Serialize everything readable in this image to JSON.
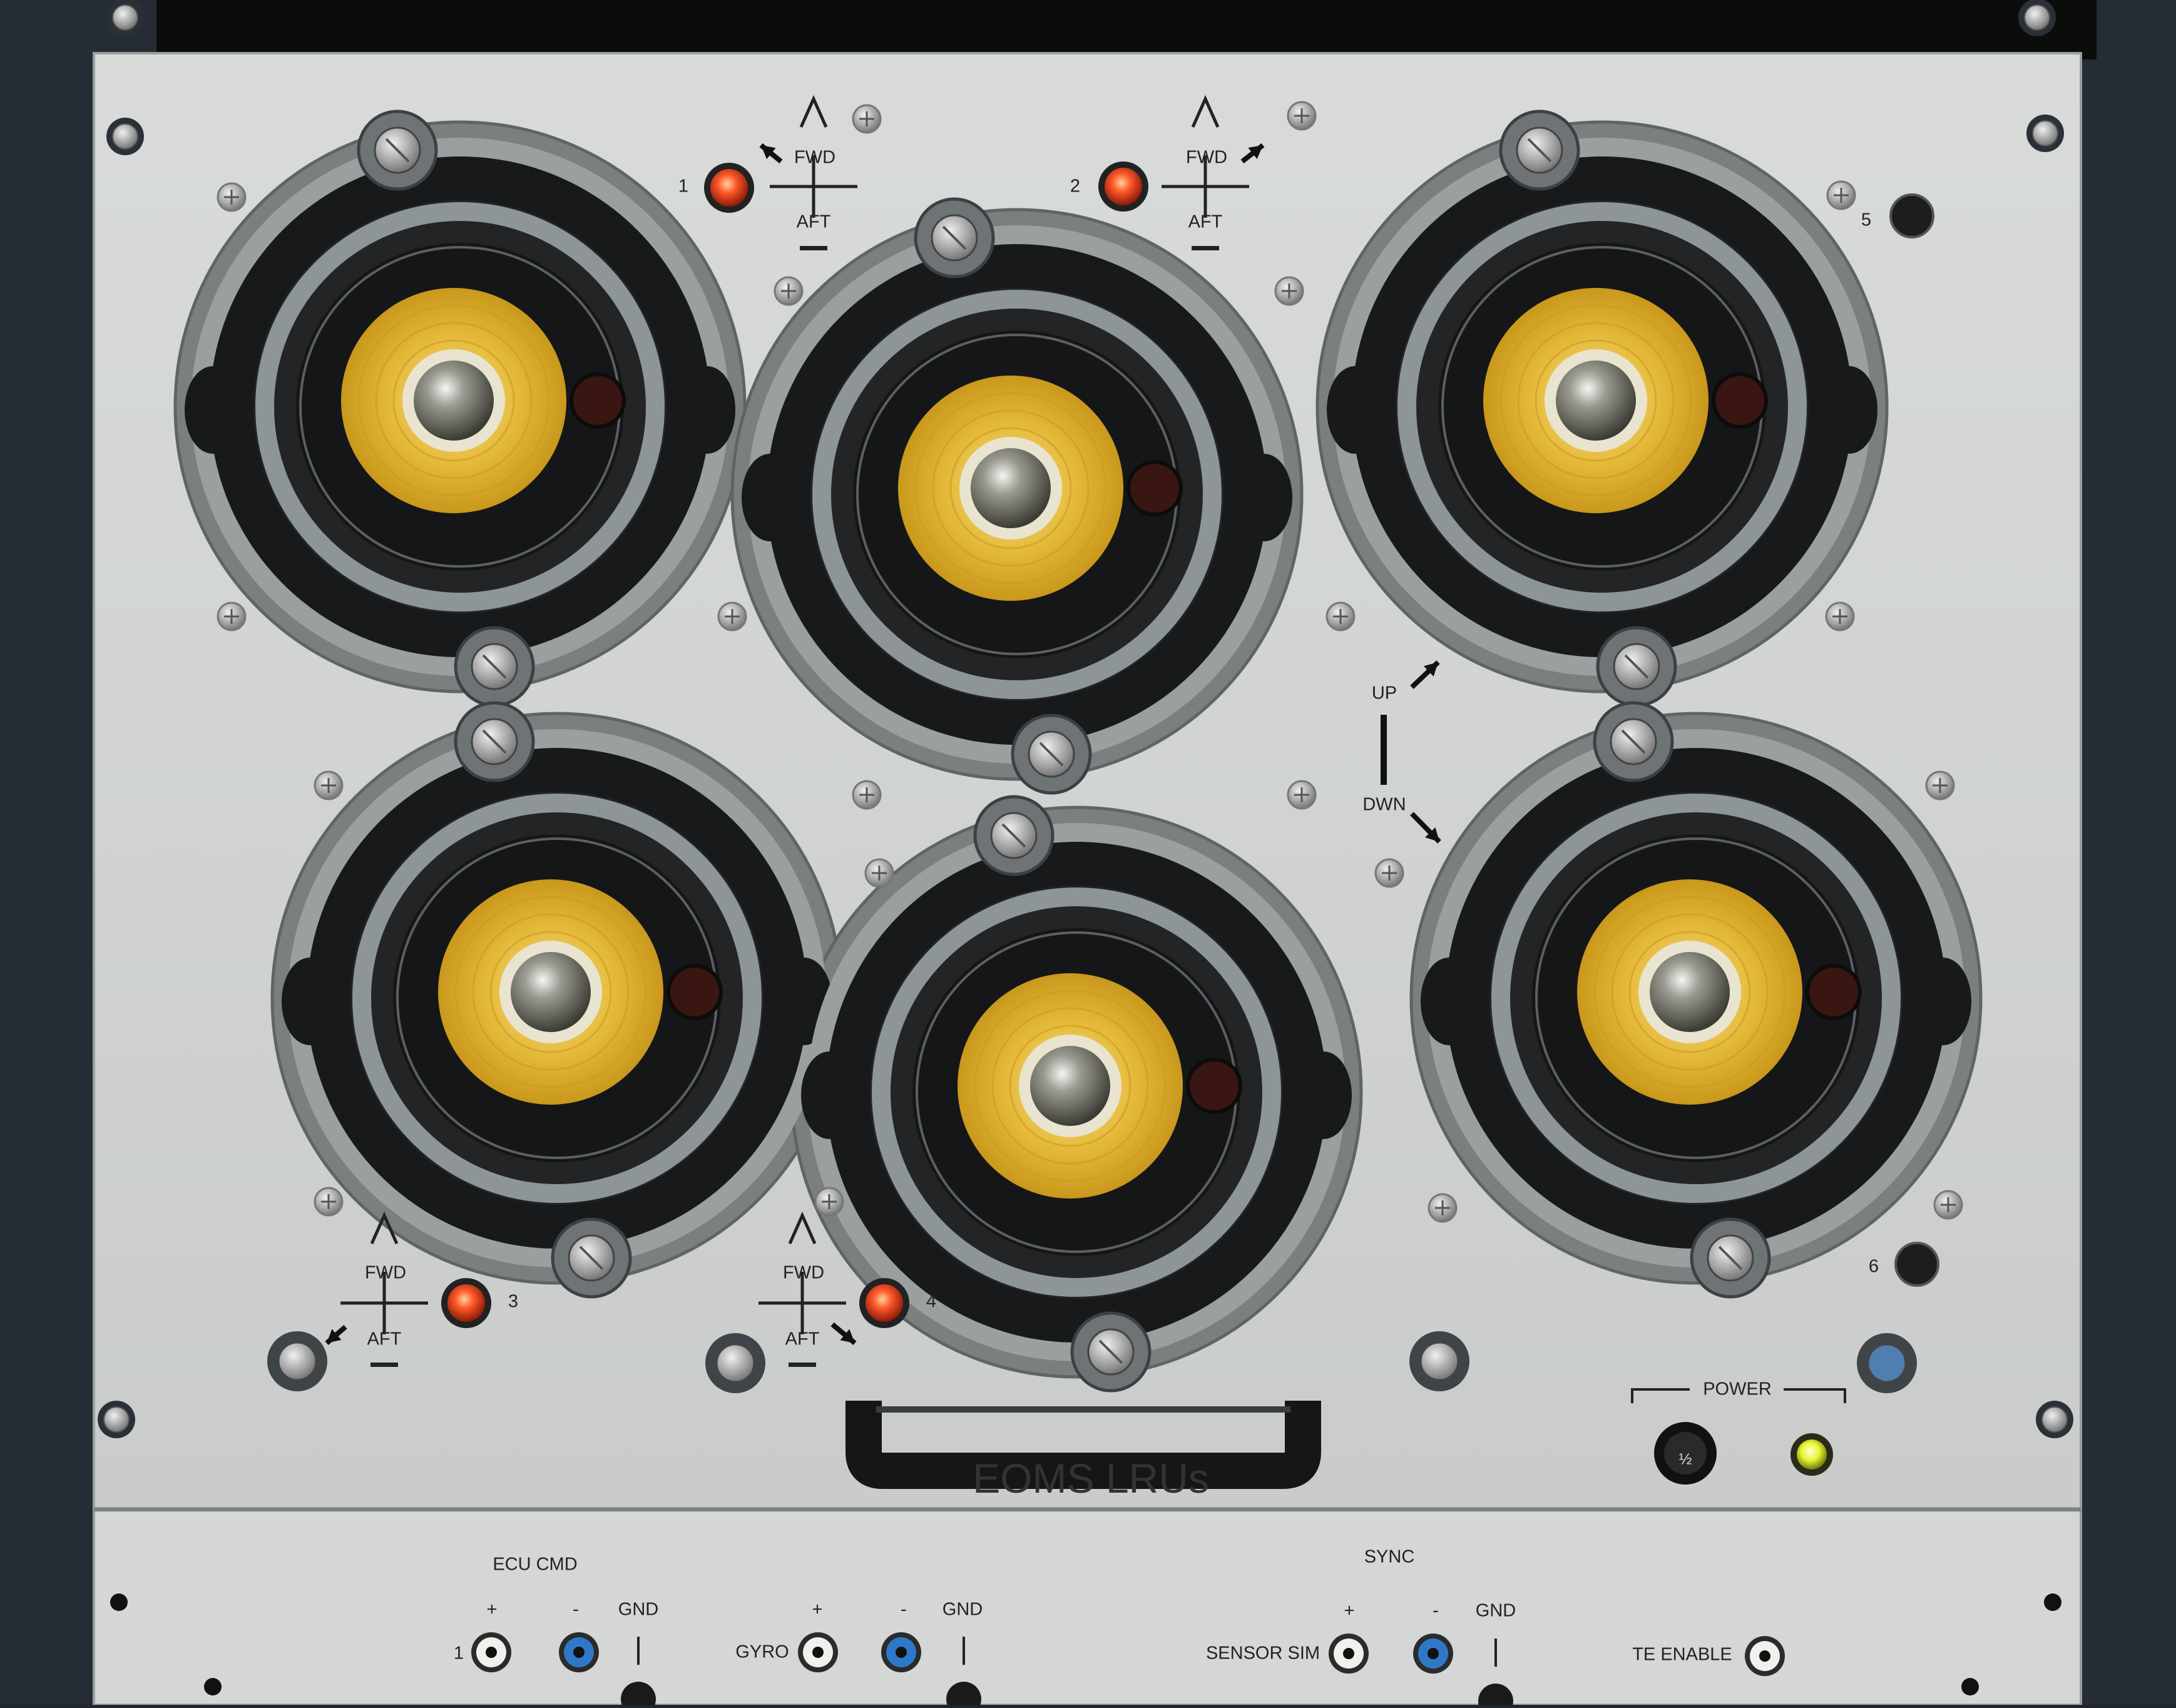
{
  "panel": {
    "title": "EOMS LRUs",
    "power_label": "POWER",
    "power_switch_label": "½"
  },
  "lamp_labels": {
    "top_left": {
      "index": "1",
      "fwd": "FWD",
      "aft": "AFT"
    },
    "top_mid": {
      "index": "2",
      "fwd": "FWD",
      "aft": "AFT"
    },
    "bottom_left": {
      "index": "3",
      "fwd": "FWD",
      "aft": "AFT"
    },
    "bottom_mid": {
      "index": "4",
      "fwd": "FWD",
      "aft": "AFT"
    },
    "right_top": {
      "index": "5"
    },
    "right_bottom": {
      "index": "6"
    }
  },
  "updown": {
    "up": "UP",
    "down": "DWN"
  },
  "connectors": {
    "ecu_cmd_label": "ECU CMD",
    "sync_label": "SYNC",
    "plus": "+",
    "minus": "-",
    "gnd": "GND",
    "row1_index": "1",
    "gyro": "GYRO",
    "sensor_sim": "SENSOR SIM",
    "te_enable": "TE ENABLE"
  },
  "colors": {
    "panel": "#d0d3d1",
    "lens_yellow": "#e3b935",
    "lamp_red": "#ff5a2a",
    "power_led": "#e8f530",
    "jack_blue": "#2f78c8"
  }
}
